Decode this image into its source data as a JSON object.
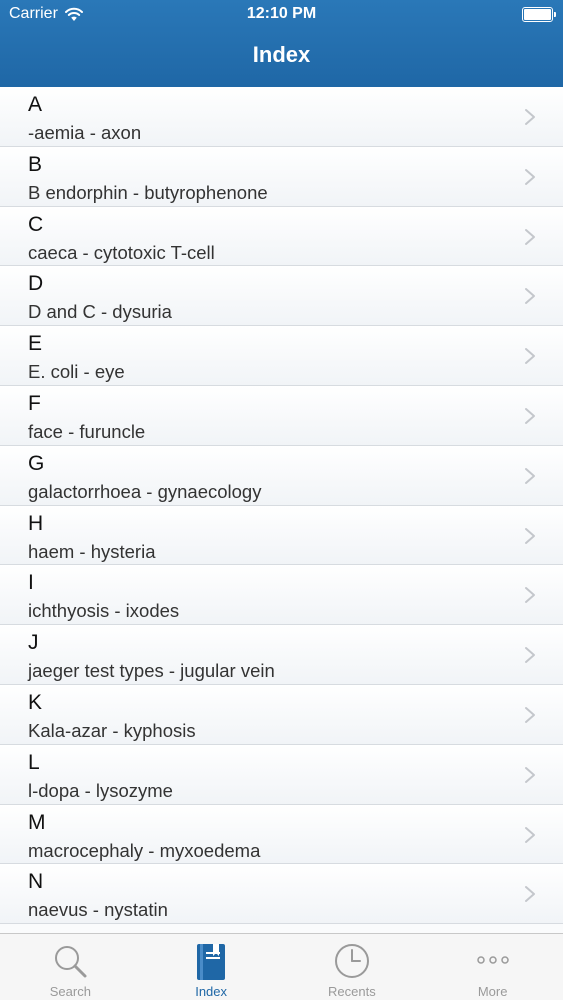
{
  "status_bar": {
    "carrier": "Carrier",
    "time": "12:10 PM"
  },
  "nav": {
    "title": "Index"
  },
  "index": {
    "items": [
      {
        "letter": "A",
        "range": "-aemia - axon"
      },
      {
        "letter": "B",
        "range": "B endorphin - butyrophenone"
      },
      {
        "letter": "C",
        "range": "caeca - cytotoxic T-cell"
      },
      {
        "letter": "D",
        "range": "D and C - dysuria"
      },
      {
        "letter": "E",
        "range": "E. coli - eye"
      },
      {
        "letter": "F",
        "range": "face - furuncle"
      },
      {
        "letter": "G",
        "range": "galactorrhoea - gynaecology"
      },
      {
        "letter": "H",
        "range": "haem - hysteria"
      },
      {
        "letter": "I",
        "range": "ichthyosis - ixodes"
      },
      {
        "letter": "J",
        "range": "jaeger test types - jugular vein"
      },
      {
        "letter": "K",
        "range": "Kala-azar - kyphosis"
      },
      {
        "letter": "L",
        "range": "l-dopa - lysozyme"
      },
      {
        "letter": "M",
        "range": "macrocephaly - myxoedema"
      },
      {
        "letter": "N",
        "range": "naevus - nystatin"
      }
    ]
  },
  "tab_bar": {
    "tabs": [
      {
        "label": "Search",
        "icon": "magnifier-icon",
        "active": false
      },
      {
        "label": "Index",
        "icon": "book-icon",
        "active": true
      },
      {
        "label": "Recents",
        "icon": "clock-icon",
        "active": false
      },
      {
        "label": "More",
        "icon": "more-dots-icon",
        "active": false
      }
    ]
  },
  "colors": {
    "header": "#1f67a6",
    "active_tab": "#1f67a6",
    "inactive_tab": "#9a9a9a"
  }
}
